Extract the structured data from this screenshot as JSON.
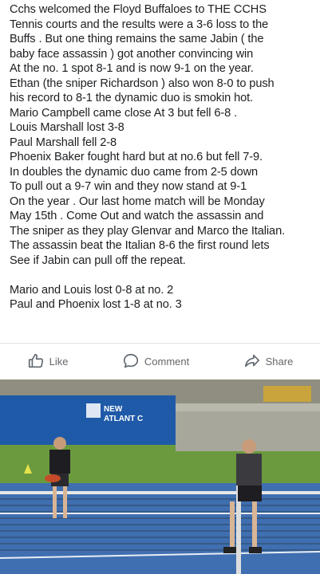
{
  "post": {
    "lines": [
      "Cchs welcomed the Floyd Buffaloes to THE CCHS",
      "Tennis courts and the results were a 3-6 loss to the",
      "Buffs . But one thing remains the same Jabin ( the",
      "baby face assassin  ) got another convincing win",
      "At the no. 1 spot  8-1 and is now 9-1 on the year.",
      "Ethan (the sniper Richardson  ) also won 8-0 to push",
      "his record to 8-1    the dynamic duo is smokin hot.",
      "Mario Campbell came close At 3 but fell 6-8 .",
      "Louis Marshall lost 3-8",
      "Paul Marshall  fell 2-8",
      "Phoenix  Baker fought hard but at no.6 but  fell  7-9.",
      "In doubles the dynamic duo came from 2-5 down",
      "To pull out a 9-7 win and they now stand at 9-1",
      "On the year . Our last home match will be Monday",
      "May 15th . Come Out and watch the assassin and",
      "The sniper as they play Glenvar and Marco the Italian.",
      "The assassin beat the Italian 8-6 the first round lets",
      "See if Jabin can pull off the repeat.",
      "",
      "Mario and Louis lost 0-8 at no. 2",
      "Paul and Phoenix lost 1-8 at no. 3"
    ]
  },
  "actions": {
    "like": "Like",
    "comment": "Comment",
    "share": "Share"
  },
  "photo": {
    "banner_text_1": "NEW",
    "banner_text_2": "ATLANT C"
  },
  "colors": {
    "text": "#1c1e21",
    "action_text": "#65676b",
    "banner_blue": "#1f5aa8",
    "court_blue": "#3f6fb0",
    "grass": "#6b9a3e"
  }
}
